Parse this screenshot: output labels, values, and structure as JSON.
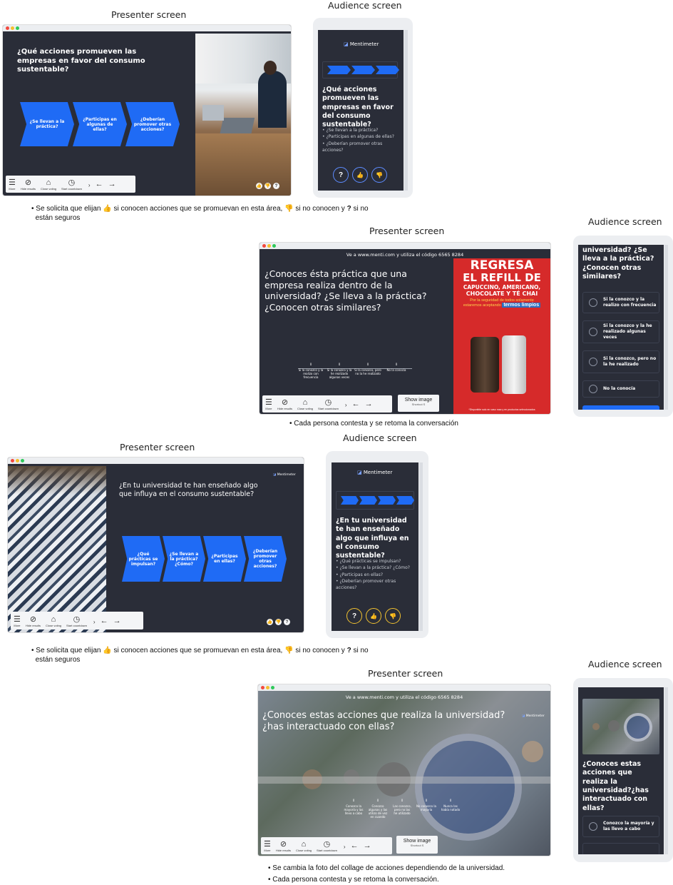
{
  "labels": {
    "presenter": "Presenter screen",
    "audience": "Audience screen"
  },
  "toolbar": {
    "more": "More",
    "hide_results": "Hide results",
    "close_voting": "Close voting",
    "start_countdown": "Start countdown",
    "show_image": "Show image",
    "show_image_shortcut": "Shortcut S"
  },
  "brand": "Mentimeter",
  "section1": {
    "question": "¿Qué acciones promueven las empresas en favor del consumo sustentable?",
    "audience_question": "¿Qué acciones promueven las empresas en favor del consumo sustentable?",
    "arrows": [
      "¿Se llevan a la práctica?",
      "¿Participas en algunas de ellas?",
      "¿Deberían promover otras acciones?"
    ],
    "bullets": [
      "¿Se llevan a la práctica?",
      "¿Participas en algunas de ellas?",
      "¿Deberían promover otras acciones?"
    ],
    "buttons": [
      "?",
      "👍",
      "👎"
    ]
  },
  "note1": {
    "a": "Se solicita que elijan",
    "b": "si conocen acciones que se promuevan en esta área,",
    "c": "si no conocen y",
    "d": "?",
    "e": "si no",
    "line2": "están seguros"
  },
  "section2": {
    "header": "Ve a www.menti.com y utiliza el código 6565 8284",
    "question": "¿Conoces ésta práctica que una empresa realiza dentro de la universidad? ¿Se lleva a la práctica? ¿Conocen otras similares?",
    "bars": [
      {
        "value": "0",
        "label": "Si la conozco y la realizo con frecuencia"
      },
      {
        "value": "0",
        "label": "Si la conozco y la he realizado algunas veces"
      },
      {
        "value": "0",
        "label": "Si la conozco, pero no la he realizado"
      },
      {
        "value": "0",
        "label": "No la conocía"
      }
    ],
    "poster": {
      "line1": "REGRESA",
      "line2": "EL REFILL DE",
      "line3": "CAPUCCINO, AMERICANO,",
      "line4": "CHOCOLATE Y TÉ CHAI",
      "line5": "Por la seguridad de todos solamente",
      "line6": "estaremos aceptando",
      "line7": "termos limpios",
      "footer": "*Disponible solo en vaso rosa y en productos seleccionados"
    },
    "audience_question": "universidad? ¿Se lleva a la práctica? ¿Conocen otras similares?",
    "options": [
      "Si la conozco y la realizo con frecuencia",
      "Si la conozco y la he realizado algunas veces",
      "Si la conozco, pero no la he realizado",
      "No la conocía"
    ]
  },
  "note2": "Cada persona contesta y se retoma la conversación",
  "section3": {
    "question": "¿En tu universidad te han enseñado algo que influya en el consumo sustentable?",
    "audience_question": "¿En tu universidad te han enseñado algo que influya en el consumo sustentable?",
    "arrows": [
      "¿Qué prácticas se impulsan?",
      "¿Se llevan a la práctica? ¿Cómo?",
      "¿Participas en ellas?",
      "¿Deberían promover otras acciones?"
    ],
    "bullets": [
      "¿Qué prácticas se impulsan?",
      "¿Se llevan a la práctica? ¿Cómo?",
      "¿Participas en ellas?",
      "¿Deberían promover otras acciones?"
    ],
    "buttons": [
      "?",
      "👍",
      "👎"
    ]
  },
  "note3": {
    "a": "Se solicita que elijan",
    "b": "si conocen acciones que se promuevan en esta área,",
    "c": "si no conocen y",
    "d": "?",
    "e": "si no",
    "line2": "están seguros"
  },
  "section4": {
    "header": "Ve a www.menti.com y utiliza el código 6565 8284",
    "question": "¿Conoces estas acciones que realiza la universidad? ¿has interactuado con ellas?",
    "bars": [
      {
        "value": "0",
        "label": "Conozco la mayoría y las llevo a cabo"
      },
      {
        "value": "0",
        "label": "Conozco algunas y las utilizo de vez en cuando"
      },
      {
        "value": "0",
        "label": "Las conozco, pero no las he utilizado"
      },
      {
        "value": "0",
        "label": "No conozco la mayoría"
      },
      {
        "value": "0",
        "label": "Nunca las había notado"
      }
    ],
    "audience_question": "¿Conoces estas acciones que realiza la universidad?¿has interactuado con ellas?",
    "options": [
      "Conozco la mayoría y las llevo a cabo"
    ]
  },
  "note4": [
    "Se cambia la foto del collage de acciones dependiendo de la universidad.",
    "Cada persona contesta y se retoma la conversación."
  ],
  "colors": {
    "slide_bg": "#2a2d38",
    "accent_blue": "#1f6bf5",
    "thumbs_up": "#c68a65",
    "thumbs_down": "#d77a67",
    "poster_red": "#d62a2a"
  }
}
